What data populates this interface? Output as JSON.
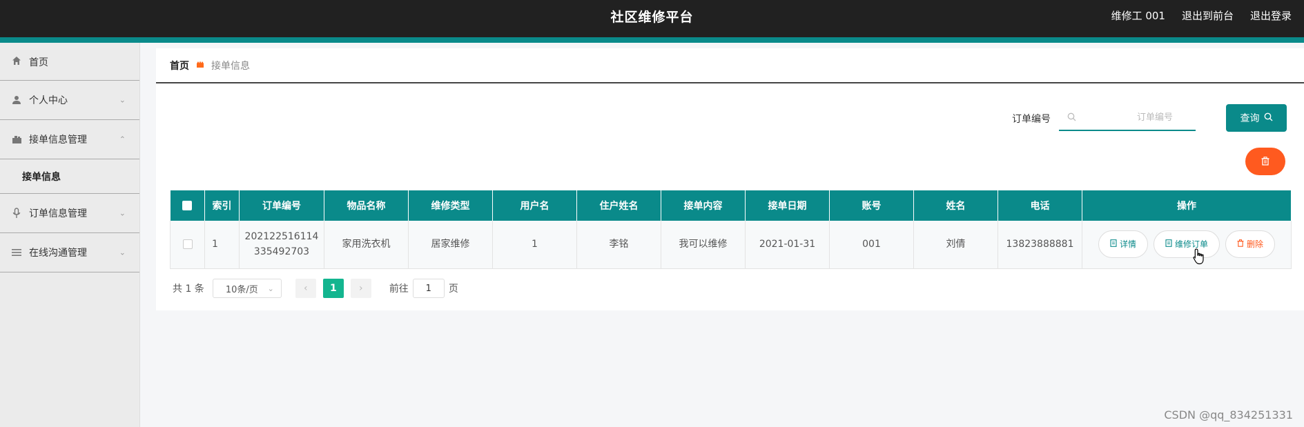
{
  "header": {
    "title": "社区维修平台",
    "user": "维修工 001",
    "to_front": "退出到前台",
    "logout": "退出登录"
  },
  "sidebar": {
    "items": [
      {
        "label": "首页",
        "icon": "home-icon"
      },
      {
        "label": "个人中心",
        "icon": "user-icon"
      },
      {
        "label": "接单信息管理",
        "icon": "briefcase-icon",
        "children": [
          {
            "label": "接单信息"
          }
        ]
      },
      {
        "label": "订单信息管理",
        "icon": "microphone-icon"
      },
      {
        "label": "在线沟通管理",
        "icon": "list-icon"
      }
    ]
  },
  "breadcrumb": {
    "home": "首页",
    "current": "接单信息"
  },
  "search": {
    "label": "订单编号",
    "placeholder": "订单编号",
    "query_label": "查询"
  },
  "table": {
    "headers": [
      "索引",
      "订单编号",
      "物品名称",
      "维修类型",
      "用户名",
      "住户姓名",
      "接单内容",
      "接单日期",
      "账号",
      "姓名",
      "电话",
      "操作"
    ],
    "rows": [
      {
        "index": "1",
        "order_no_line1": "202122516114",
        "order_no_line2": "335492703",
        "item": "家用洗衣机",
        "repair_type": "居家维修",
        "username": "1",
        "resident": "李铭",
        "content": "我可以维修",
        "date": "2021-01-31",
        "account": "001",
        "name": "刘倩",
        "phone": "13823888881"
      }
    ],
    "actions": {
      "detail": "详情",
      "repair": "维修订单",
      "delete": "删除"
    }
  },
  "pagination": {
    "total": "共 1 条",
    "page_size": "10条/页",
    "current_page": "1",
    "goto_label": "前往",
    "goto_value": "1",
    "page_suffix": "页"
  },
  "watermark": "CSDN @qq_834251331",
  "colors": {
    "header_bg": "#212121",
    "accent": "#0a8a8a",
    "danger": "#ff5a1f",
    "page_active": "#13b58f"
  }
}
